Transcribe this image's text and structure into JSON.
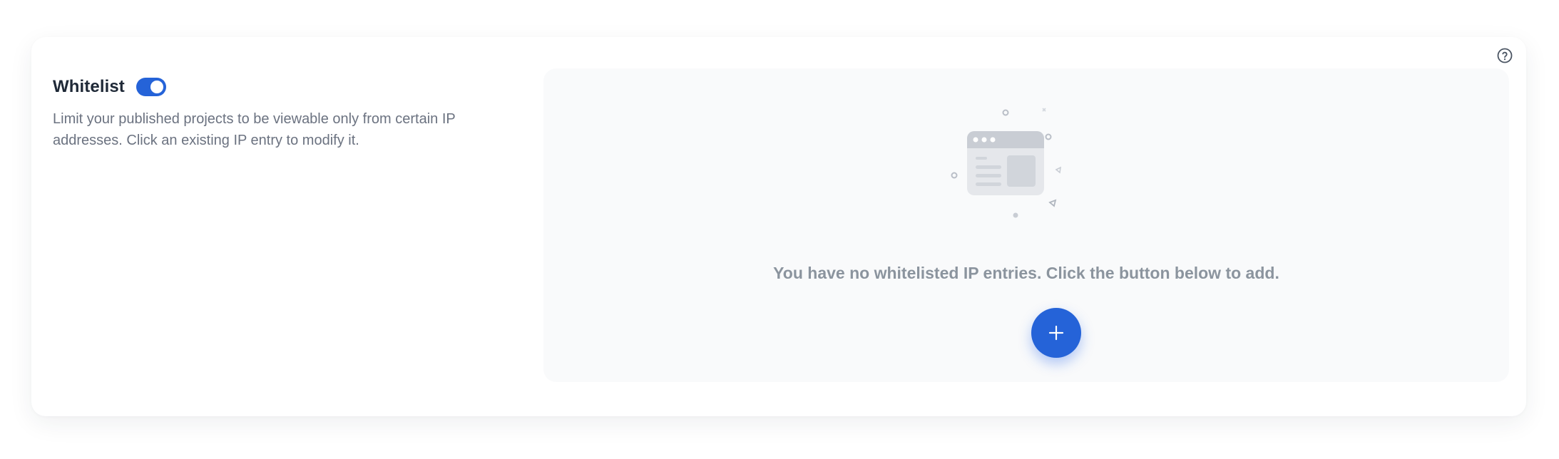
{
  "whitelist": {
    "title": "Whitelist",
    "toggle_enabled": true,
    "description": "Limit your published projects to be viewable only from certain IP addresses. Click an existing IP entry to modify it."
  },
  "empty_state": {
    "message": "You have no whitelisted IP entries. Click the button below to add.",
    "illustration_icon": "browser-window-icon",
    "add_button_icon": "plus-icon"
  },
  "help": {
    "icon": "question-circle-icon"
  },
  "colors": {
    "accent": "#2563d8",
    "muted_text": "#8b949e",
    "body_text": "#6b7280",
    "title_text": "#1f2937",
    "panel_bg": "#f9fafb"
  }
}
